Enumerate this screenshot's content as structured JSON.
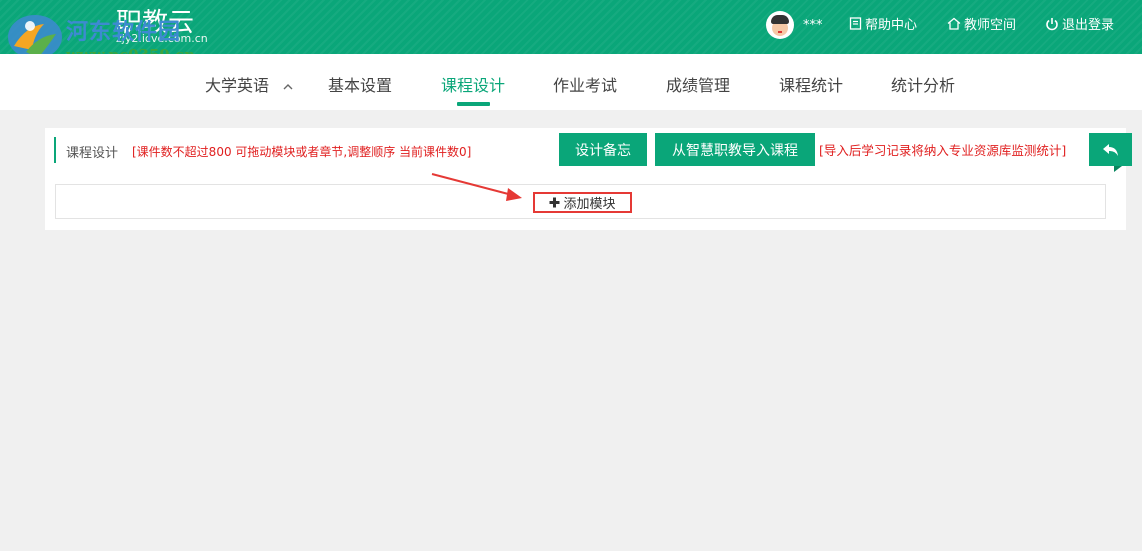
{
  "header": {
    "brand_title": "职教云",
    "brand_subtitle": "zjy2.icve.com.cn",
    "user_name": "***",
    "help_center": "帮助中心",
    "teacher_space": "教师空间",
    "logout": "退出登录"
  },
  "watermark": {
    "site_name": "河东软件园",
    "site_url": "www.pc0359.cn"
  },
  "menu": {
    "course_name": "大学英语",
    "items": [
      "基本设置",
      "课程设计",
      "作业考试",
      "成绩管理",
      "课程统计",
      "统计分析"
    ],
    "active_index": 1
  },
  "panel": {
    "title": "课程设计",
    "note": "[课件数不超过800 可拖动模块或者章节,调整顺序 当前课件数0]",
    "design_memo_button": "设计备忘",
    "import_button": "从智慧职教导入课程",
    "import_note": "[导入后学习记录将纳入专业资源库监测统计]",
    "add_module_button": "添加模块"
  },
  "colors": {
    "brand_green": "#0aa679",
    "warning_red": "#e02020",
    "highlight_red": "#e53935"
  },
  "icons": {
    "help": "document-icon",
    "teacher_space": "home-icon",
    "logout": "power-icon",
    "back": "reply-arrow-icon",
    "add": "plus-icon",
    "menu_toggle": "chevron-up-icon"
  }
}
